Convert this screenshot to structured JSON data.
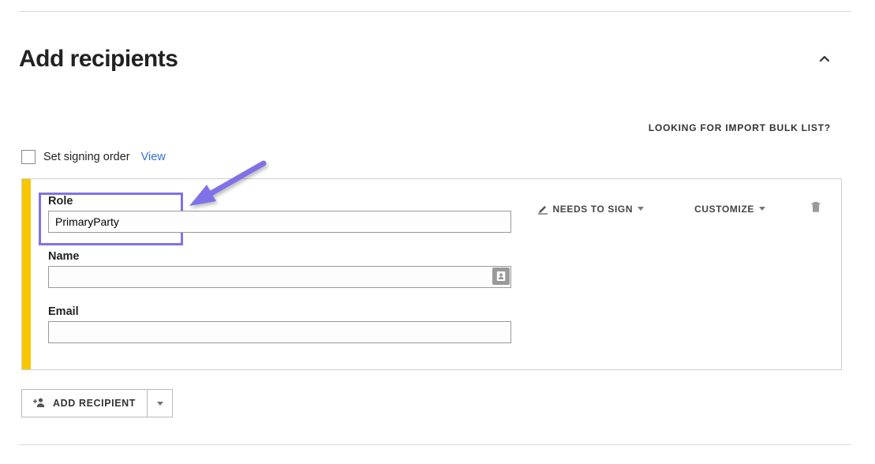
{
  "header": {
    "title": "Add recipients"
  },
  "bulk_link": {
    "text": "LOOKING FOR IMPORT BULK LIST?"
  },
  "signing_order": {
    "checkbox_checked": false,
    "label": "Set signing order",
    "view_link_label": "View"
  },
  "recipient": {
    "role_label": "Role",
    "role_value": "PrimaryParty",
    "name_label": "Name",
    "name_value": "",
    "email_label": "Email",
    "email_value": "",
    "actions": {
      "needs_to_sign_label": "NEEDS TO SIGN",
      "customize_label": "CUSTOMIZE"
    }
  },
  "add_button": {
    "label": "ADD RECIPIENT"
  },
  "annotation": {
    "highlight_target": "role-field",
    "arrow_color": "#8072e6"
  }
}
